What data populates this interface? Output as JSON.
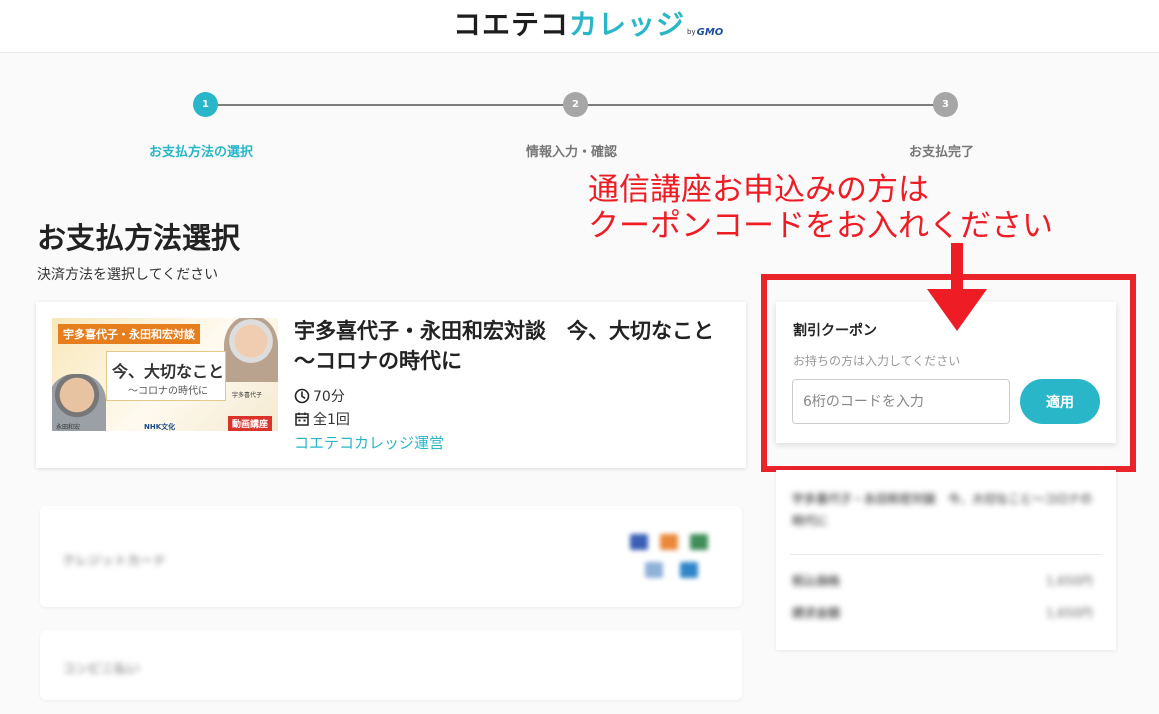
{
  "header": {
    "logo_text_dark": "コエテコ",
    "logo_text_accent": "カレッジ",
    "logo_by": "by",
    "logo_gmo": "GMO"
  },
  "stepper": {
    "steps": [
      {
        "number": "1",
        "label": "お支払方法の選択",
        "active": true
      },
      {
        "number": "2",
        "label": "情報入力・確認",
        "active": false
      },
      {
        "number": "3",
        "label": "お支払完了",
        "active": false
      }
    ]
  },
  "page": {
    "title": "お支払方法選択",
    "subtitle": "決済方法を選択してください"
  },
  "course": {
    "title": "宇多喜代子・永田和宏対談　今、大切なこと～コロナの時代に",
    "duration": "70分",
    "sessions": "全1回",
    "organizer": "コエテコカレッジ運営",
    "thumbnail": {
      "banner": "宇多喜代子・永田和宏対談",
      "main_text": "今、大切なこと",
      "sub_text": "～コロナの時代に",
      "tag": "動画講座",
      "brand": "NHK文化",
      "caption_left": "永田和宏",
      "caption_right": "宇多喜代子"
    }
  },
  "payment_methods": [
    {
      "label": "クレジットカード"
    },
    {
      "label": "コンビニ払い"
    }
  ],
  "coupon": {
    "title": "割引クーポン",
    "description": "お持ちの方は入力してください",
    "input_placeholder": "6桁のコードを入力",
    "apply_label": "適用"
  },
  "annotation": {
    "line1": "通信講座お申込みの方は",
    "line2": "クーポンコードをお入れください"
  },
  "summary": {
    "course_title": "宇多喜代子・永田和宏対談　今、大切なこと～コロナの時代に",
    "row1_label": "税込価格",
    "row1_value": "1,650円",
    "row2_label": "請求金額",
    "row2_value": "1,650円"
  },
  "colors": {
    "accent": "#29b6c9",
    "inactive_step": "#a6a6a6",
    "annotation_red": "#ee1c24"
  }
}
